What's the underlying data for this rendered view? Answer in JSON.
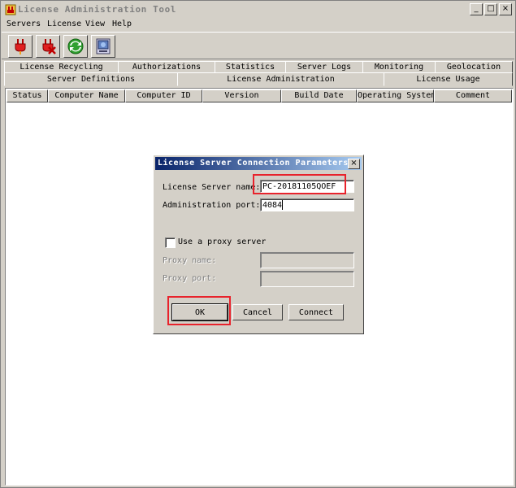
{
  "window": {
    "title": "License Administration Tool",
    "min": "_",
    "max": "□",
    "close": "×"
  },
  "menu": [
    "Servers",
    "License",
    "View",
    "Help"
  ],
  "tabs_back": [
    "License Recycling",
    "Authorizations",
    "Statistics",
    "Server Logs",
    "Monitoring",
    "Geolocation"
  ],
  "tabs_front": [
    "Server Definitions",
    "License Administration",
    "License Usage"
  ],
  "table": {
    "columns": [
      "Status",
      "Computer Name",
      "Computer ID",
      "Version",
      "Build Date",
      "Operating System",
      "Comment"
    ]
  },
  "dialog": {
    "title": "License Server Connection Parameters",
    "close": "×",
    "server_name_label": "License Server name:",
    "server_name_value": "PC-20181105QOEF",
    "port_label": "Administration port:",
    "port_value": "4084",
    "proxy_checkbox": "Use a proxy server",
    "proxy_name_label": "Proxy name:",
    "proxy_port_label": "Proxy port:",
    "ok": "OK",
    "cancel": "Cancel",
    "connect": "Connect"
  },
  "colors": {
    "highlight": "#e8232c",
    "titlebar_active": "#0a246a"
  }
}
